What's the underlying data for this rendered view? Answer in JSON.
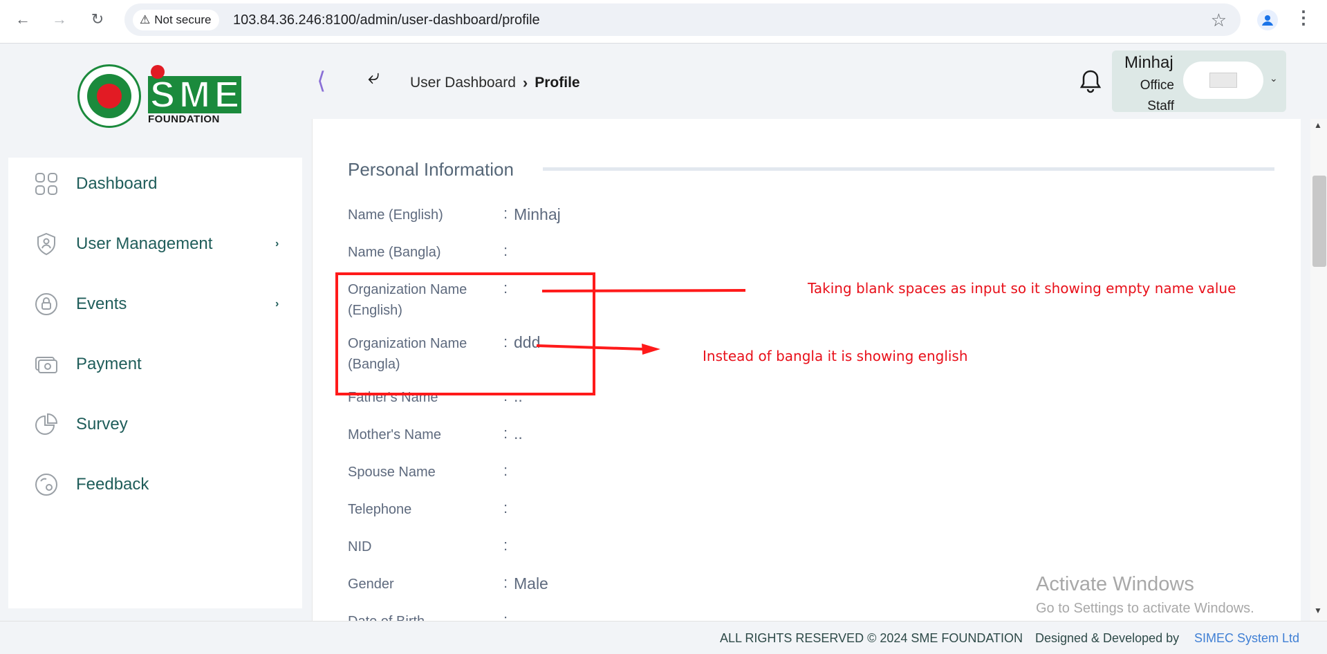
{
  "browser": {
    "security_label": "Not secure",
    "url": "103.84.36.246:8100/admin/user-dashboard/profile"
  },
  "header": {
    "brand_letters": [
      "S",
      "M",
      "E"
    ],
    "brand_sub": "FOUNDATION",
    "breadcrumb": [
      "User Dashboard",
      "Profile"
    ],
    "user": {
      "name": "Minhaj",
      "role_line1": "Office",
      "role_line2": "Staff"
    }
  },
  "sidebar": {
    "items": [
      {
        "label": "Dashboard",
        "icon": "grid-icon",
        "expandable": false
      },
      {
        "label": "User Management",
        "icon": "shield-user-icon",
        "expandable": true
      },
      {
        "label": "Events",
        "icon": "lock-circle-icon",
        "expandable": true
      },
      {
        "label": "Payment",
        "icon": "money-icon",
        "expandable": false
      },
      {
        "label": "Survey",
        "icon": "pie-chart-icon",
        "expandable": false
      },
      {
        "label": "Feedback",
        "icon": "feedback-icon",
        "expandable": false
      }
    ]
  },
  "profile": {
    "section_title": "Personal Information",
    "rows": [
      {
        "label": "Name (English)",
        "value": "Minhaj"
      },
      {
        "label": "Name (Bangla)",
        "value": ""
      },
      {
        "label": "Organization Name (English)",
        "value": ""
      },
      {
        "label": "Organization Name (Bangla)",
        "value": "ddd"
      },
      {
        "label": "Father's Name",
        "value": ".."
      },
      {
        "label": "Mother's Name",
        "value": ".."
      },
      {
        "label": "Spouse Name",
        "value": ""
      },
      {
        "label": "Telephone",
        "value": ""
      },
      {
        "label": "NID",
        "value": ""
      },
      {
        "label": "Gender",
        "value": "Male"
      },
      {
        "label": "Date of Birth",
        "value": ""
      }
    ],
    "separator": ":"
  },
  "annotations": {
    "note_blank": "Taking blank spaces as input so it showing empty name value",
    "note_bangla": "Instead of bangla it is showing english",
    "color": "#ff1a1a"
  },
  "watermark": {
    "title": "Activate Windows",
    "subtitle": "Go to Settings to activate Windows."
  },
  "footer": {
    "rights": "ALL RIGHTS RESERVED © 2024 SME FOUNDATION",
    "designed_by": "Designed & Developed by",
    "company": "SIMEC System Ltd"
  },
  "colors": {
    "brand_green": "#1b8a3c",
    "brand_red": "#e21b24",
    "sidebar_text": "#1f5d5a",
    "link_blue": "#3f7fd4"
  }
}
